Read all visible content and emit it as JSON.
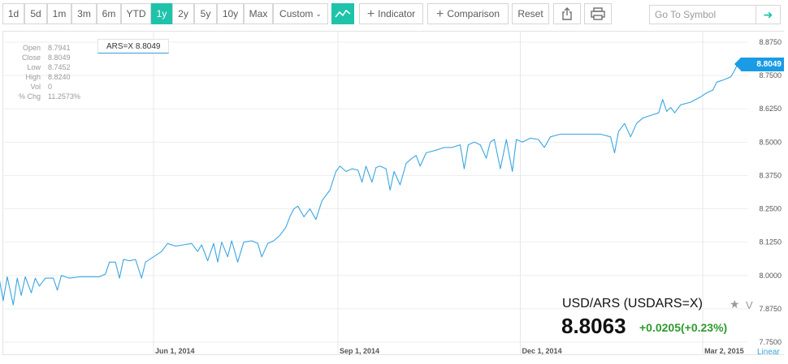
{
  "toolbar": {
    "ranges": [
      "1d",
      "5d",
      "1m",
      "3m",
      "6m",
      "YTD",
      "1y",
      "2y",
      "5y",
      "10y",
      "Max"
    ],
    "active_range": "1y",
    "custom_label": "Custom",
    "indicator_label": "Indicator",
    "comparison_label": "Comparison",
    "reset_label": "Reset",
    "symbol_placeholder": "Go To Symbol"
  },
  "ohlc": {
    "rows": [
      {
        "label": "Open",
        "value": "8.7941"
      },
      {
        "label": "Close",
        "value": "8.8049"
      },
      {
        "label": "Low",
        "value": "8.7452"
      },
      {
        "label": "High",
        "value": "8.8240"
      },
      {
        "label": "Vol",
        "value": "0"
      },
      {
        "label": "% Chg",
        "value": "11.2573%"
      }
    ]
  },
  "tooltip": "ARS=X 8.8049",
  "last_price_tag": "8.8049",
  "quote": {
    "name": "USD/ARS (USDARS=X)",
    "price": "8.8063",
    "change": "+0.0205(+0.23%)",
    "v_label": "V"
  },
  "scale_label": "Linear",
  "colors": {
    "accent": "#1fc3a9",
    "line": "#3aa6e0",
    "up": "#2e9a2e",
    "tag": "#1a9be6"
  },
  "chart_data": {
    "type": "line",
    "title": "",
    "xlabel": "",
    "ylabel": "",
    "ylim": [
      7.75,
      8.875
    ],
    "y_ticks": [
      7.75,
      7.875,
      8.0,
      8.125,
      8.25,
      8.375,
      8.5,
      8.625,
      8.75,
      8.875
    ],
    "y_tick_labels": [
      "7.7500",
      "7.8750",
      "8.0000",
      "8.1250",
      "8.2500",
      "8.3750",
      "8.5000",
      "8.6250",
      "8.7500",
      "8.8750"
    ],
    "x_ticks": [
      {
        "label": "Jun 1, 2014",
        "date": "2014-06-01"
      },
      {
        "label": "Sep 1, 2014",
        "date": "2014-09-01"
      },
      {
        "label": "Dec 1, 2014",
        "date": "2014-12-01"
      },
      {
        "label": "Mar 2, 2015",
        "date": "2015-03-02"
      }
    ],
    "grid": true,
    "series": [
      {
        "points": [
          [
            "2014-03-05",
            7.865
          ],
          [
            "2014-03-08",
            7.905
          ],
          [
            "2014-03-11",
            7.83
          ],
          [
            "2014-03-13",
            7.985
          ],
          [
            "2014-03-16",
            7.99
          ],
          [
            "2014-03-18",
            7.905
          ],
          [
            "2014-03-20",
            7.995
          ],
          [
            "2014-03-23",
            7.89
          ],
          [
            "2014-03-25",
            7.99
          ],
          [
            "2014-03-27",
            7.925
          ],
          [
            "2014-03-29",
            7.995
          ],
          [
            "2014-04-01",
            7.935
          ],
          [
            "2014-04-03",
            7.99
          ],
          [
            "2014-04-05",
            7.96
          ],
          [
            "2014-04-08",
            7.99
          ],
          [
            "2014-04-12",
            7.99
          ],
          [
            "2014-04-14",
            7.945
          ],
          [
            "2014-04-16",
            8.0
          ],
          [
            "2014-04-20",
            7.99
          ],
          [
            "2014-04-25",
            7.995
          ],
          [
            "2014-04-30",
            7.995
          ],
          [
            "2014-05-05",
            7.995
          ],
          [
            "2014-05-08",
            8.005
          ],
          [
            "2014-05-10",
            8.05
          ],
          [
            "2014-05-13",
            8.05
          ],
          [
            "2014-05-15",
            7.99
          ],
          [
            "2014-05-17",
            8.06
          ],
          [
            "2014-05-20",
            8.055
          ],
          [
            "2014-05-23",
            8.06
          ],
          [
            "2014-05-26",
            7.99
          ],
          [
            "2014-05-28",
            8.05
          ],
          [
            "2014-06-01",
            8.07
          ],
          [
            "2014-06-05",
            8.09
          ],
          [
            "2014-06-08",
            8.12
          ],
          [
            "2014-06-12",
            8.11
          ],
          [
            "2014-06-16",
            8.115
          ],
          [
            "2014-06-20",
            8.12
          ],
          [
            "2014-06-23",
            8.09
          ],
          [
            "2014-06-25",
            8.115
          ],
          [
            "2014-06-28",
            8.055
          ],
          [
            "2014-07-01",
            8.12
          ],
          [
            "2014-07-03",
            8.05
          ],
          [
            "2014-07-05",
            8.125
          ],
          [
            "2014-07-08",
            8.07
          ],
          [
            "2014-07-10",
            8.13
          ],
          [
            "2014-07-13",
            8.05
          ],
          [
            "2014-07-16",
            8.125
          ],
          [
            "2014-07-20",
            8.13
          ],
          [
            "2014-07-23",
            8.12
          ],
          [
            "2014-07-25",
            8.07
          ],
          [
            "2014-07-28",
            8.12
          ],
          [
            "2014-07-31",
            8.13
          ],
          [
            "2014-08-03",
            8.15
          ],
          [
            "2014-08-06",
            8.18
          ],
          [
            "2014-08-08",
            8.22
          ],
          [
            "2014-08-10",
            8.25
          ],
          [
            "2014-08-12",
            8.26
          ],
          [
            "2014-08-15",
            8.22
          ],
          [
            "2014-08-18",
            8.25
          ],
          [
            "2014-08-21",
            8.21
          ],
          [
            "2014-08-24",
            8.28
          ],
          [
            "2014-08-28",
            8.32
          ],
          [
            "2014-08-31",
            8.39
          ],
          [
            "2014-09-02",
            8.41
          ],
          [
            "2014-09-05",
            8.39
          ],
          [
            "2014-09-08",
            8.4
          ],
          [
            "2014-09-11",
            8.395
          ],
          [
            "2014-09-13",
            8.35
          ],
          [
            "2014-09-15",
            8.41
          ],
          [
            "2014-09-18",
            8.35
          ],
          [
            "2014-09-20",
            8.405
          ],
          [
            "2014-09-22",
            8.41
          ],
          [
            "2014-09-25",
            8.4
          ],
          [
            "2014-09-27",
            8.32
          ],
          [
            "2014-09-29",
            8.39
          ],
          [
            "2014-10-02",
            8.34
          ],
          [
            "2014-10-05",
            8.42
          ],
          [
            "2014-10-08",
            8.44
          ],
          [
            "2014-10-10",
            8.45
          ],
          [
            "2014-10-12",
            8.41
          ],
          [
            "2014-10-15",
            8.46
          ],
          [
            "2014-10-20",
            8.47
          ],
          [
            "2014-10-24",
            8.48
          ],
          [
            "2014-10-28",
            8.48
          ],
          [
            "2014-11-01",
            8.49
          ],
          [
            "2014-11-03",
            8.4
          ],
          [
            "2014-11-05",
            8.49
          ],
          [
            "2014-11-08",
            8.5
          ],
          [
            "2014-11-11",
            8.49
          ],
          [
            "2014-11-14",
            8.44
          ],
          [
            "2014-11-16",
            8.5
          ],
          [
            "2014-11-18",
            8.51
          ],
          [
            "2014-11-21",
            8.4
          ],
          [
            "2014-11-24",
            8.51
          ],
          [
            "2014-11-27",
            8.39
          ],
          [
            "2014-11-29",
            8.51
          ],
          [
            "2014-12-02",
            8.5
          ],
          [
            "2014-12-06",
            8.515
          ],
          [
            "2014-12-10",
            8.51
          ],
          [
            "2014-12-13",
            8.48
          ],
          [
            "2014-12-16",
            8.52
          ],
          [
            "2014-12-21",
            8.53
          ],
          [
            "2014-12-28",
            8.53
          ],
          [
            "2015-01-04",
            8.53
          ],
          [
            "2015-01-10",
            8.53
          ],
          [
            "2015-01-15",
            8.52
          ],
          [
            "2015-01-17",
            8.46
          ],
          [
            "2015-01-19",
            8.54
          ],
          [
            "2015-01-22",
            8.57
          ],
          [
            "2015-01-25",
            8.52
          ],
          [
            "2015-01-28",
            8.57
          ],
          [
            "2015-01-31",
            8.59
          ],
          [
            "2015-02-04",
            8.6
          ],
          [
            "2015-02-08",
            8.61
          ],
          [
            "2015-02-10",
            8.66
          ],
          [
            "2015-02-12",
            8.615
          ],
          [
            "2015-02-14",
            8.63
          ],
          [
            "2015-02-16",
            8.61
          ],
          [
            "2015-02-19",
            8.64
          ],
          [
            "2015-02-24",
            8.65
          ],
          [
            "2015-03-01",
            8.67
          ],
          [
            "2015-03-04",
            8.685
          ],
          [
            "2015-03-07",
            8.695
          ],
          [
            "2015-03-09",
            8.725
          ],
          [
            "2015-03-13",
            8.735
          ],
          [
            "2015-03-16",
            8.745
          ],
          [
            "2015-03-18",
            8.77
          ],
          [
            "2015-03-20",
            8.805
          ]
        ]
      }
    ]
  }
}
